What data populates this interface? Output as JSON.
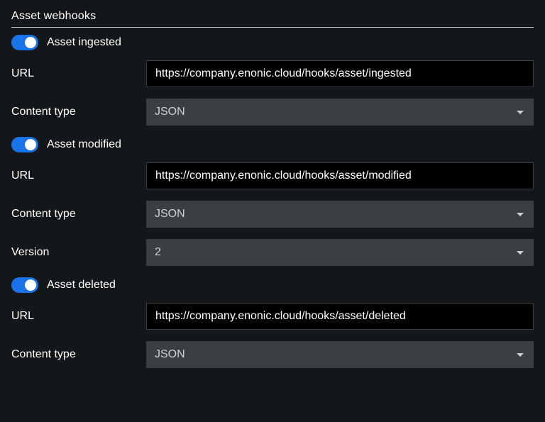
{
  "section_title": "Asset webhooks",
  "webhooks": [
    {
      "toggle_label": "Asset ingested",
      "toggle_on": true,
      "url_label": "URL",
      "url_value": "https://company.enonic.cloud/hooks/asset/ingested",
      "content_type_label": "Content type",
      "content_type_value": "JSON"
    },
    {
      "toggle_label": "Asset modified",
      "toggle_on": true,
      "url_label": "URL",
      "url_value": "https://company.enonic.cloud/hooks/asset/modified",
      "content_type_label": "Content type",
      "content_type_value": "JSON",
      "version_label": "Version",
      "version_value": "2"
    },
    {
      "toggle_label": "Asset deleted",
      "toggle_on": true,
      "url_label": "URL",
      "url_value": "https://company.enonic.cloud/hooks/asset/deleted",
      "content_type_label": "Content type",
      "content_type_value": "JSON"
    }
  ]
}
